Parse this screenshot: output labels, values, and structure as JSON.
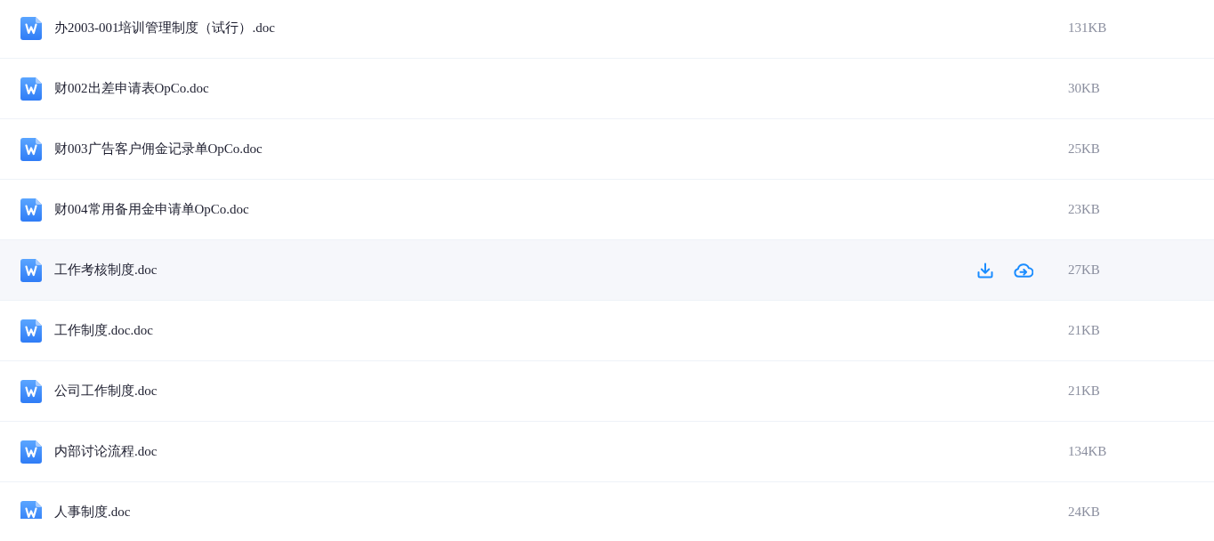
{
  "files": [
    {
      "name": "办2003-001培训管理制度（试行）.doc",
      "size": "131KB",
      "hovered": false
    },
    {
      "name": "财002出差申请表OpCo.doc",
      "size": "30KB",
      "hovered": false
    },
    {
      "name": "财003广告客户佣金记录单OpCo.doc",
      "size": "25KB",
      "hovered": false
    },
    {
      "name": "财004常用备用金申请单OpCo.doc",
      "size": "23KB",
      "hovered": false
    },
    {
      "name": "工作考核制度.doc",
      "size": "27KB",
      "hovered": true
    },
    {
      "name": "工作制度.doc.doc",
      "size": "21KB",
      "hovered": false
    },
    {
      "name": "公司工作制度.doc",
      "size": "21KB",
      "hovered": false
    },
    {
      "name": "内部讨论流程.doc",
      "size": "134KB",
      "hovered": false
    },
    {
      "name": "人事制度.doc",
      "size": "24KB",
      "hovered": false
    }
  ]
}
